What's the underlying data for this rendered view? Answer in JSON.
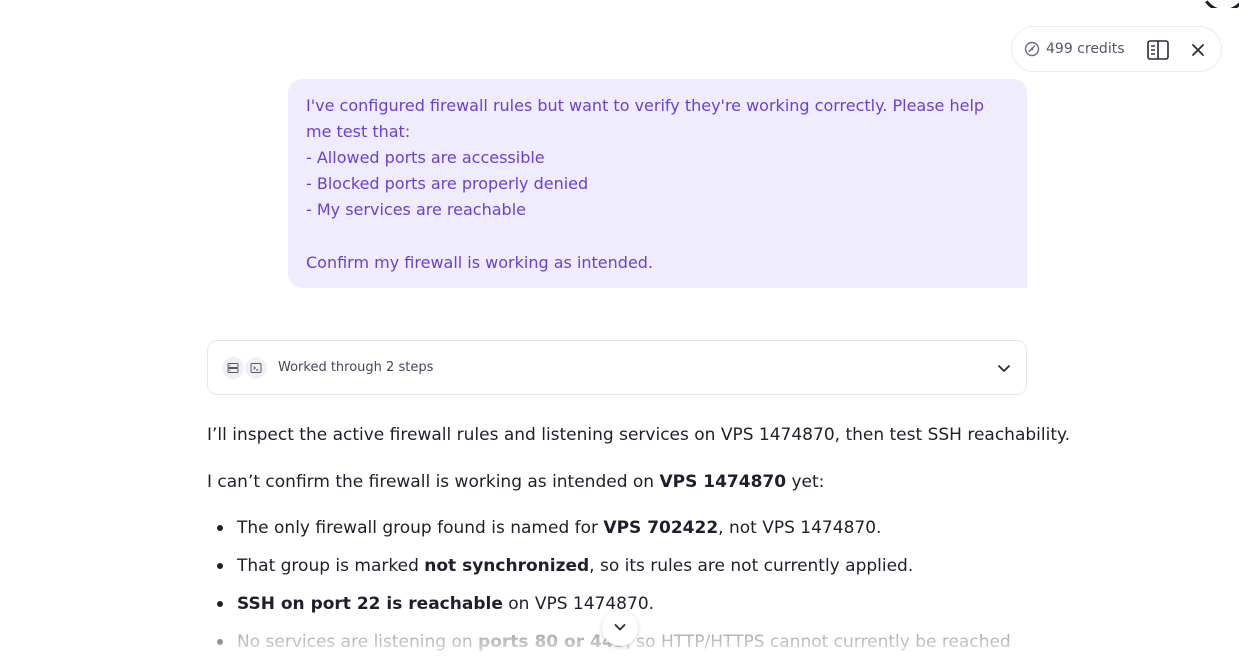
{
  "header": {
    "credits_label": "499 credits",
    "credits_icon": "credits-gauge-icon",
    "panel_icon": "split-panel-icon",
    "close_icon": "close-icon"
  },
  "user_message": {
    "lines": [
      "I've configured firewall rules but want to verify they're working correctly. Please help me test that:",
      "- Allowed ports are accessible",
      "- Blocked ports are properly denied",
      "- My services are reachable",
      "",
      "Confirm my firewall is working as intended."
    ]
  },
  "steps": {
    "label": "Worked through 2 steps",
    "icons": [
      "server-icon",
      "terminal-icon"
    ]
  },
  "answer": {
    "intro": "I’ll inspect the active firewall rules and listening services on VPS 1474870, then test SSH reachability.",
    "summary_pre": "I can’t confirm the firewall is working as intended on ",
    "summary_bold": "VPS 1474870",
    "summary_post": " yet:",
    "bullets": [
      {
        "pre": "The only firewall group found is named for ",
        "bold": "VPS 702422",
        "post": ", not VPS 1474870."
      },
      {
        "pre": "That group is marked ",
        "bold": "not synchronized",
        "post": ", so its rules are not currently applied."
      },
      {
        "pre": "",
        "bold": "SSH on port 22 is reachable",
        "post": " on VPS 1474870."
      },
      {
        "pre": "No services are listening on ",
        "bold": "ports 80 or 443",
        "post": ", so HTTP/HTTPS cannot currently be reached"
      }
    ]
  },
  "colors": {
    "accent": "#6a3fd8",
    "bubble_bg": "#efecfd"
  }
}
